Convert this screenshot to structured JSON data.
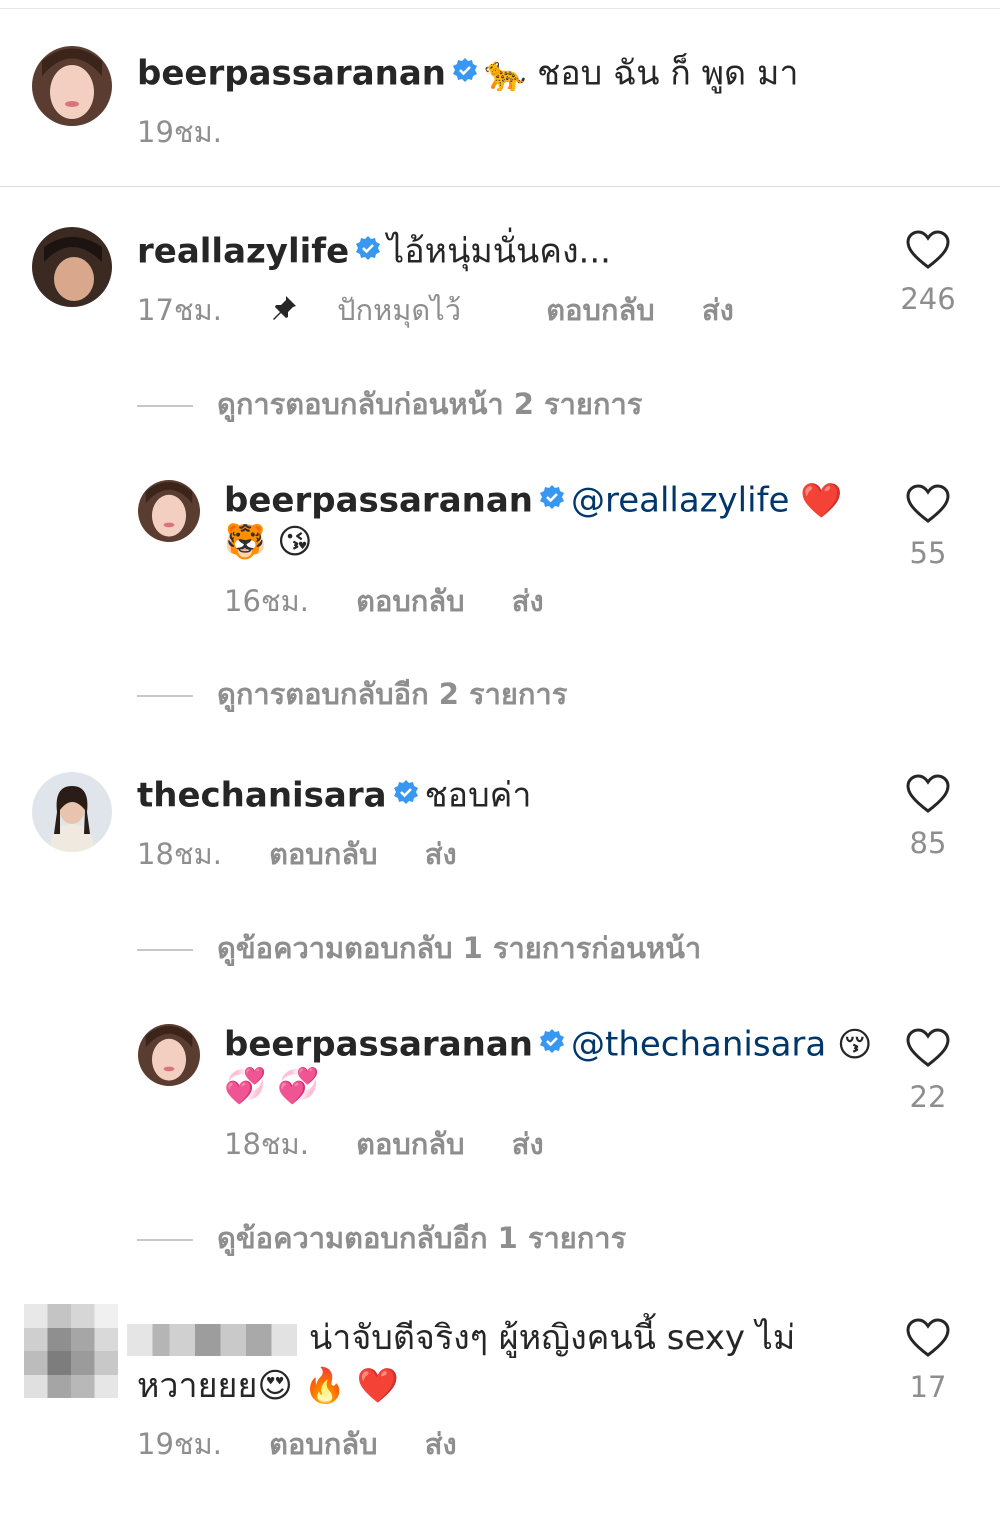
{
  "post": {
    "username": "beerpassaranan",
    "caption_emoji": "🐆",
    "caption_text": "ชอบ  ฉัน ก็ พูด มา",
    "time": "19ชม."
  },
  "comments": [
    {
      "username": "reallazylife",
      "text": "ไอ้หนุ่มนั่นคง...",
      "time": "17ชม.",
      "pinned_label": "ปักหมุดไว้",
      "reply_label": "ตอบกลับ",
      "send_label": "ส่ง",
      "likes": "246",
      "view_previous": "ดูการตอบกลับก่อนหน้า 2 รายการ",
      "reply": {
        "username": "beerpassaranan",
        "mention": "@reallazylife",
        "emoji_line1": "❤️",
        "emoji_line2": "🐯 😘",
        "time": "16ชม.",
        "reply_label": "ตอบกลับ",
        "send_label": "ส่ง",
        "likes": "55"
      },
      "view_more": "ดูการตอบกลับอีก 2 รายการ"
    },
    {
      "username": "thechanisara",
      "text": "ชอบค่า",
      "time": "18ชม.",
      "reply_label": "ตอบกลับ",
      "send_label": "ส่ง",
      "likes": "85",
      "view_previous": "ดูข้อความตอบกลับ 1 รายการก่อนหน้า",
      "reply": {
        "username": "beerpassaranan",
        "mention": "@thechanisara",
        "emoji_line1": "😚",
        "emoji_line2": "💞 💞",
        "time": "18ชม.",
        "reply_label": "ตอบกลับ",
        "send_label": "ส่ง",
        "likes": "22"
      },
      "view_more": "ดูข้อความตอบกลับอีก 1 รายการ"
    },
    {
      "text_line1": "น่าจับตีจริงๆ ผู้หญิงคนนี้ sexy ไม่",
      "text_line2": "หวายยย",
      "emojis": "😍 🔥 ❤️",
      "time": "19ชม.",
      "reply_label": "ตอบกลับ",
      "send_label": "ส่ง",
      "likes": "17"
    }
  ],
  "colors": {
    "text": "#262626",
    "secondary": "#8e8e8e",
    "verified": "#3897f0",
    "mention": "#00376b",
    "separator": "#dbdbdb"
  }
}
